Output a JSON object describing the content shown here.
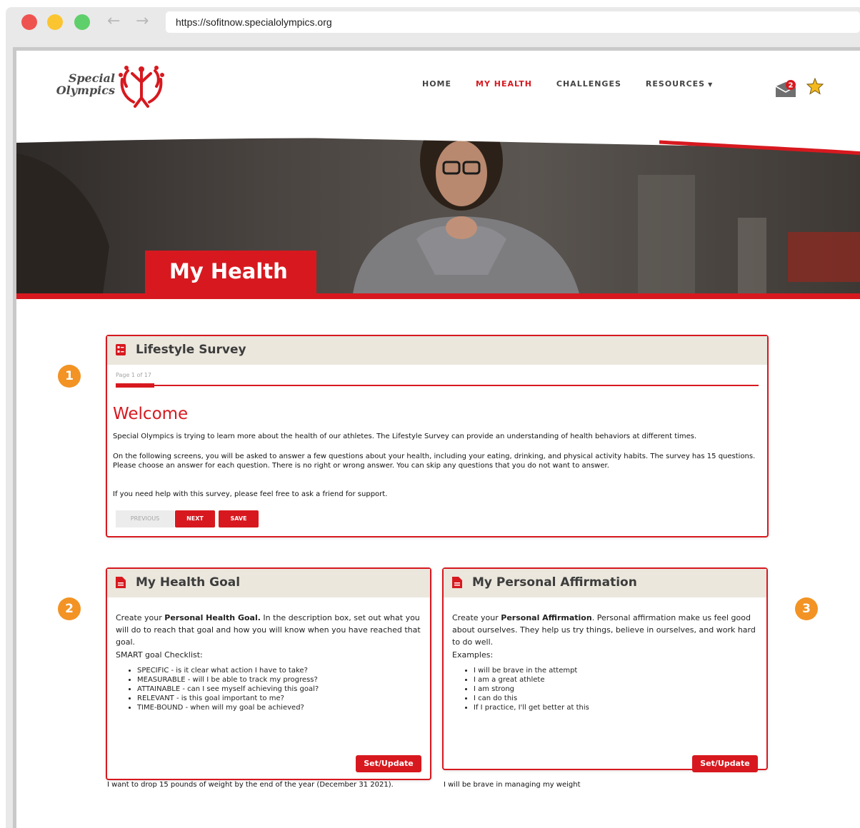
{
  "browser": {
    "url": "https://sofitnow.specialolympics.org"
  },
  "logo": {
    "line1": "Special",
    "line2": "Olympics"
  },
  "nav": {
    "items": [
      {
        "label": "HOME"
      },
      {
        "label": "MY HEALTH",
        "active": true
      },
      {
        "label": "CHALLENGES"
      },
      {
        "label": "RESOURCES"
      }
    ],
    "notification_count": "2"
  },
  "hero": {
    "title": "My Health"
  },
  "steps": [
    "1",
    "2",
    "3"
  ],
  "survey": {
    "title": "Lifestyle Survey",
    "page_info": "Page 1 of 17",
    "progress": 0.06,
    "heading": "Welcome",
    "paragraph1": "Special Olympics is trying to learn more about the health of our athletes. The Lifestyle Survey can provide an understanding of health behaviors at different times.",
    "paragraph2": "On the following screens, you will be asked to answer a few questions about your health, including your eating, drinking, and physical activity habits.  The survey has 15 questions.  Please choose an answer for each question. There is no right or wrong answer.  You can skip any questions that you do not want to answer.",
    "paragraph3": "If you need help with this survey, please feel free to ask a friend for support.",
    "btn_previous": "PREVIOUS",
    "btn_next": "NEXT",
    "btn_save": "SAVE"
  },
  "goal": {
    "title": "My Health Goal",
    "intro_pre": "Create your ",
    "intro_bold": "Personal Health Goal.",
    "intro_post": " In the description box, set out what you will do to reach that goal and how you will know when you have reached that goal.",
    "subheading": "SMART goal Checklist:",
    "checklist": [
      "SPECIFIC - is it clear what action I have to take?",
      "MEASURABLE - will I be able to track my progress?",
      "ATTAINABLE - can I see myself achieving this goal?",
      "RELEVANT - is this goal important to me?",
      "TIME-BOUND - when will my goal be achieved?"
    ],
    "button": "Set/Update",
    "saved_value": "I want to drop 15 pounds of weight by the end of the year (December 31 2021)."
  },
  "affirmation": {
    "title": "My Personal Affirmation",
    "intro_pre": "Create your ",
    "intro_bold": "Personal Affirmation",
    "intro_post": ". Personal affirmation make us feel good about ourselves. They help us try things, believe in ourselves, and work hard to do well.",
    "subheading": "Examples:",
    "examples": [
      "I will be brave in the attempt",
      "I am a great athlete",
      "I am strong",
      "I can do this",
      "If I practice, I'll get better at this"
    ],
    "button": "Set/Update",
    "saved_value": "I will be brave in managing my weight"
  },
  "colors": {
    "brand_red": "#d7191f",
    "step_orange": "#f29324",
    "card_header": "#ebe7dd"
  },
  "icons": [
    "back-arrow-icon",
    "forward-arrow-icon",
    "mail-icon",
    "star-icon",
    "survey-icon",
    "document-icon"
  ]
}
